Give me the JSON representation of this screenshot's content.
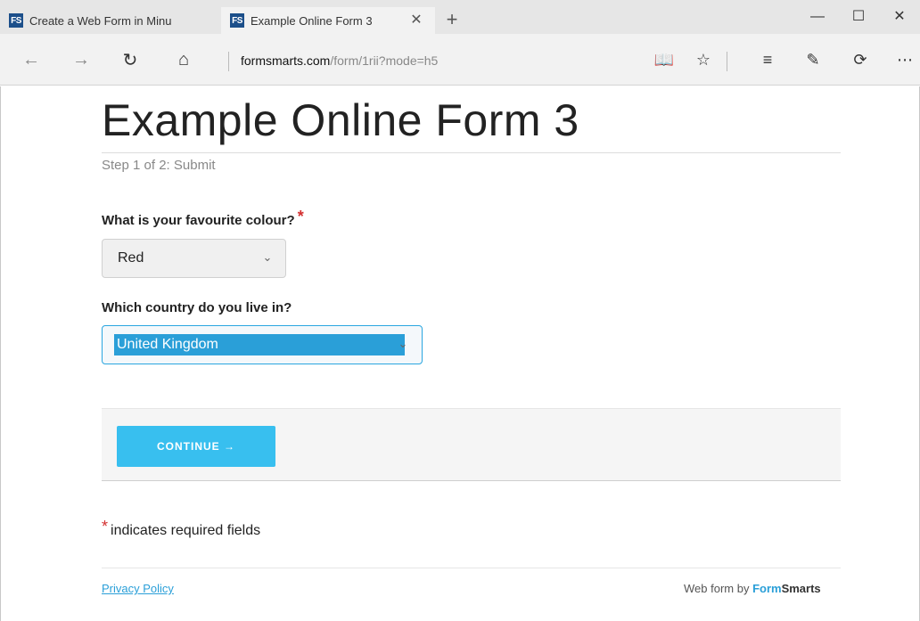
{
  "browser": {
    "tabs": [
      {
        "badge": "FS",
        "title": "Create a Web Form in Minu"
      },
      {
        "badge": "FS",
        "title": "Example Online Form 3",
        "close": "✕"
      }
    ],
    "new_tab": "+",
    "window_controls": {
      "minimize": "—",
      "maximize": "☐",
      "close": "✕"
    },
    "nav": {
      "back": "←",
      "forward": "→",
      "refresh": "↻",
      "home": "⌂"
    },
    "address": {
      "domain": "formsmarts.com",
      "path": "/form/1rii?mode=h5"
    },
    "toolbar": {
      "reading": "📖",
      "favorite": "☆",
      "hub": "≡",
      "note": "✎",
      "share": "⟳",
      "more": "⋯"
    }
  },
  "form": {
    "title": "Example Online Form 3",
    "step": "Step 1 of 2: Submit",
    "questions": [
      {
        "label": "What is your favourite colour?",
        "required_mark": "*",
        "value": "Red"
      },
      {
        "label": "Which country do you live in?",
        "value": "United Kingdom"
      }
    ],
    "continue_label": "CONTINUE →",
    "required_note": {
      "mark": "*",
      "text": "indicates required fields"
    }
  },
  "footer": {
    "privacy": "Privacy Policy",
    "powered_prefix": "Web form by ",
    "brand_form": "Form",
    "brand_smarts": "Smarts"
  },
  "colors": {
    "accent": "#38bfef",
    "required": "#d32f2f",
    "link": "#2a9fd8",
    "badge": "#1c4f8a"
  }
}
